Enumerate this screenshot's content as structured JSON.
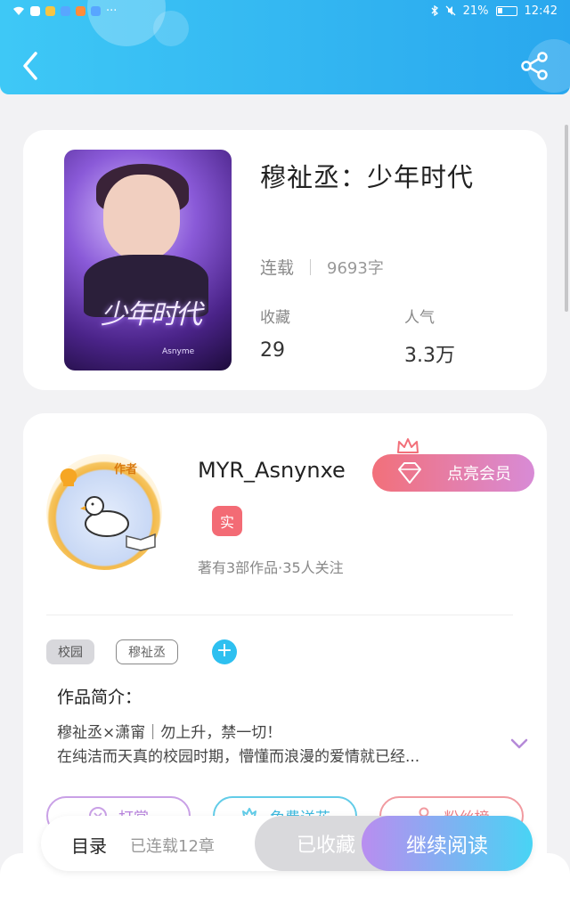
{
  "status_bar": {
    "battery": "21%",
    "time": "12:42",
    "more": "···"
  },
  "book": {
    "title": "穆祉丞：少年时代",
    "status": "连载",
    "word_count": "9693字",
    "favorites_label": "收藏",
    "favorites_value": "29",
    "popularity_label": "人气",
    "popularity_value": "3.3万",
    "cover_title_art": "少年时代",
    "cover_credit": "Asnyme"
  },
  "author": {
    "tag": "作者",
    "name": "MYR_Asnynxe",
    "verified_badge": "实",
    "meta": "著有3部作品·35人关注",
    "vip_button": "点亮会员"
  },
  "tags": [
    "校园",
    "穆祉丞"
  ],
  "intro": {
    "title": "作品简介：",
    "line1": "穆祉丞×潇甯｜勿上升，禁一切！",
    "line2": "在纯洁而天真的校园时期，懵懂而浪漫的爱情就已经..."
  },
  "actions": {
    "reward": "打赏",
    "flower": "免费送花",
    "fans": "粉丝榜"
  },
  "bottom_bar": {
    "toc": "目录",
    "chapters": "已连载12章",
    "collected": "已收藏",
    "continue_reading": "继续阅读"
  },
  "icons": {
    "back": "chevron-left-icon",
    "share": "share-icon",
    "expand": "chevron-down-icon"
  },
  "colors": {
    "header": "#33b6f1",
    "accent_blue": "#2ec0f0",
    "vip_pink": "#f2707a",
    "read_gradient_start": "#b98df0",
    "read_gradient_end": "#48d4f4"
  }
}
